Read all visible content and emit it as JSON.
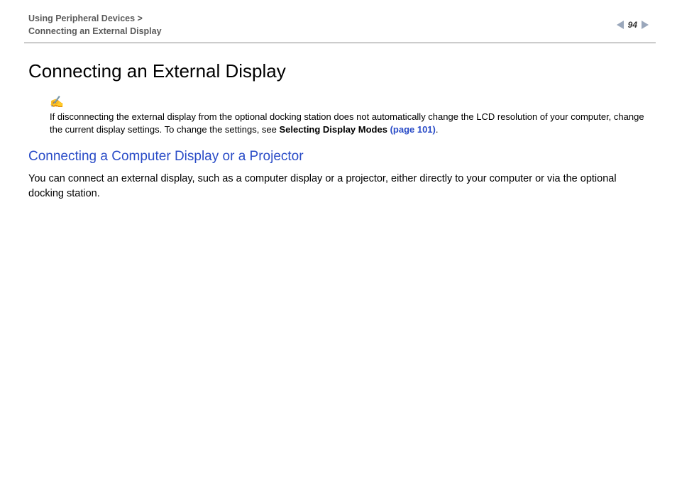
{
  "header": {
    "breadcrumb_line1": "Using Peripheral Devices >",
    "breadcrumb_line2": "Connecting an External Display",
    "page_number": "94"
  },
  "content": {
    "h1": "Connecting an External Display",
    "note": {
      "icon": "✍",
      "text_part1": "If disconnecting the external display from the optional docking station does not automatically change the LCD resolution of your computer, change the current display settings. To change the settings, see ",
      "bold_text": "Selecting Display Modes ",
      "link_text": "(page 101)",
      "text_part2": "."
    },
    "h2": "Connecting a Computer Display or a Projector",
    "body": "You can connect an external display, such as a computer display or a projector, either directly to your computer or via the optional docking station."
  }
}
